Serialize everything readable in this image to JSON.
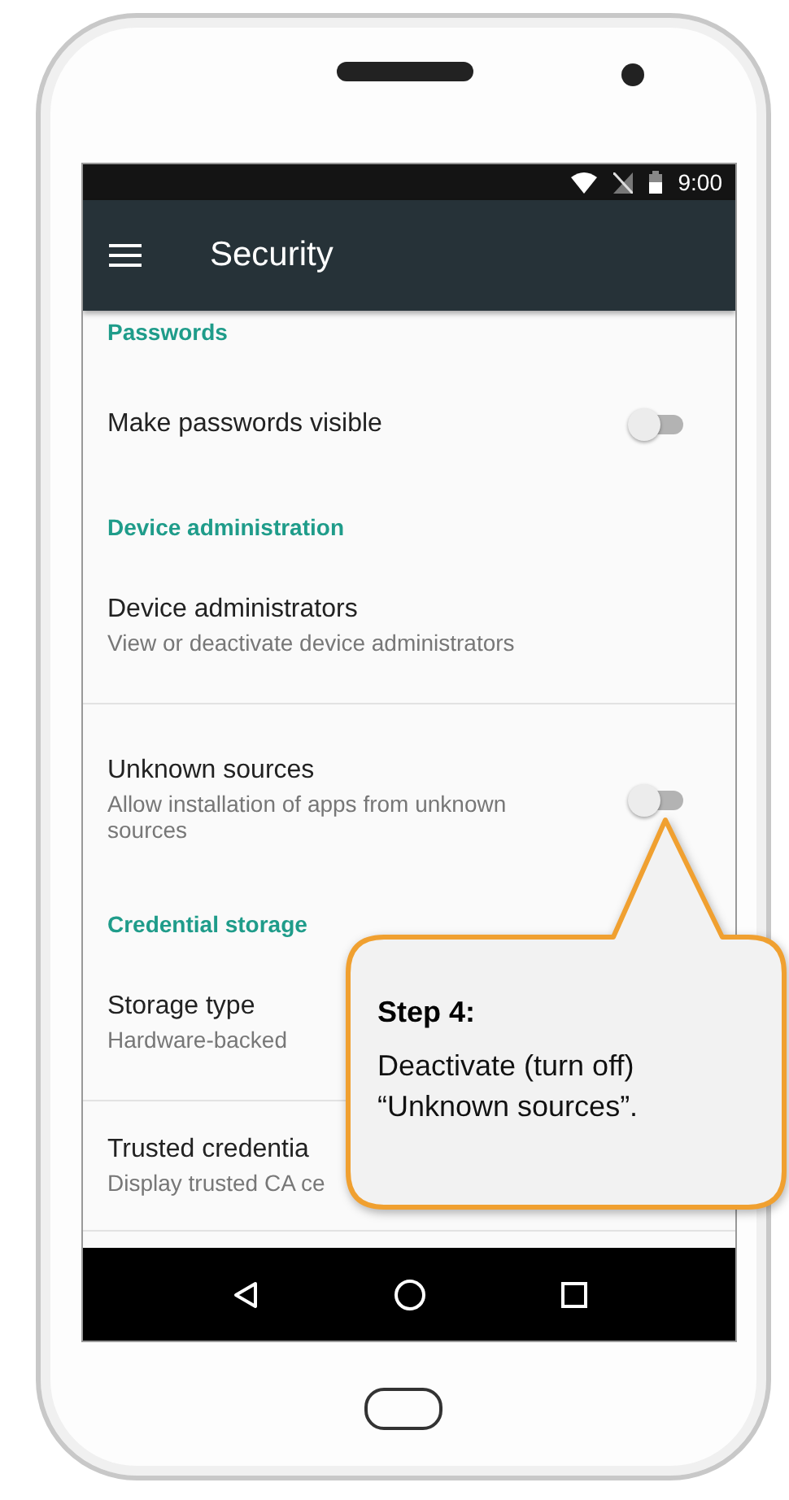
{
  "status_bar": {
    "time": "9:00"
  },
  "toolbar": {
    "title": "Security"
  },
  "settings": [
    {
      "kind": "header",
      "title": "Passwords"
    },
    {
      "kind": "toggle",
      "title": "Make passwords visible",
      "on": false,
      "divider": false
    },
    {
      "kind": "header",
      "title": "Device administration"
    },
    {
      "kind": "text",
      "title": "Device administrators",
      "subtitle": "View or deactivate device administrators",
      "divider": true
    },
    {
      "kind": "toggle",
      "title": "Unknown sources",
      "subtitle": "Allow installation of apps from unknown sources",
      "on": false,
      "divider": false
    },
    {
      "kind": "header",
      "title": "Credential storage"
    },
    {
      "kind": "text",
      "title": "Storage type",
      "subtitle": "Hardware-backed",
      "divider": true
    },
    {
      "kind": "text",
      "title": "Trusted credentia",
      "subtitle": "Display trusted CA ce",
      "divider": true
    }
  ],
  "callout": {
    "title": "Step 4:",
    "text": "Deactivate (turn off) “Unknown sources”."
  }
}
